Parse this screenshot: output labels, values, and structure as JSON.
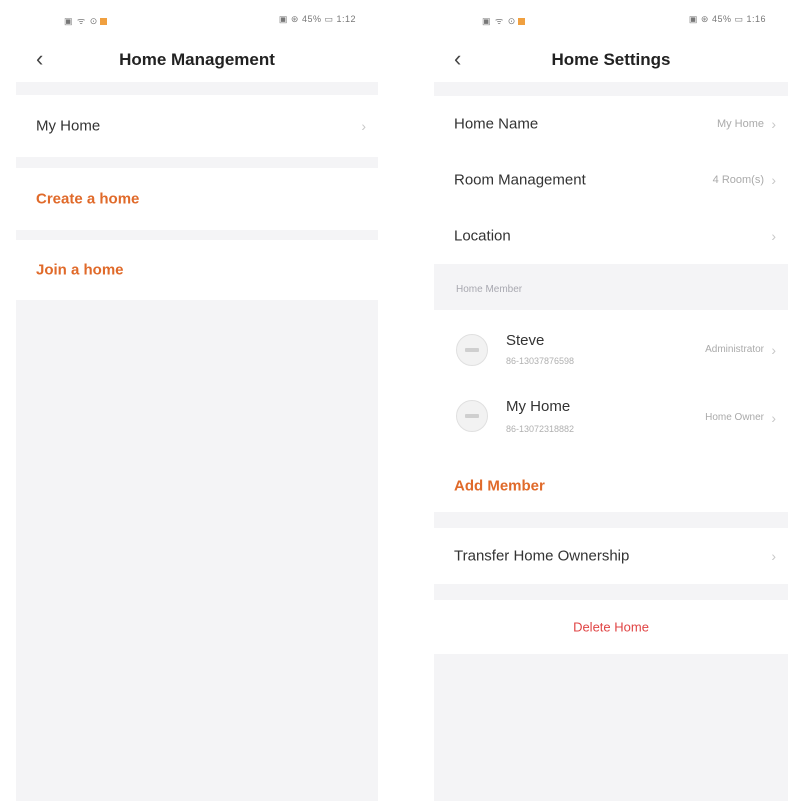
{
  "left": {
    "status": {
      "left": "▣ ᯤ ⊙",
      "right": "▣ ⊛ 45% ▭ 1:12"
    },
    "nav": {
      "title": "Home Management"
    },
    "items": {
      "my_home": "My Home",
      "create": "Create a home",
      "join": "Join a home"
    }
  },
  "right": {
    "status": {
      "left": "▣ ᯤ ⊙",
      "right": "▣ ⊛ 45% ▭ 1:16"
    },
    "nav": {
      "title": "Home Settings"
    },
    "settings": {
      "home_name": {
        "label": "Home Name",
        "value": "My Home"
      },
      "room_mgmt": {
        "label": "Room Management",
        "value": "4 Room(s)"
      },
      "location": {
        "label": "Location"
      }
    },
    "section_header": "Home Member",
    "members": [
      {
        "name": "Steve",
        "id": "86-13037876598",
        "role": "Administrator"
      },
      {
        "name": "My Home",
        "id": "86-13072318882",
        "role": "Home Owner"
      }
    ],
    "add_member": "Add Member",
    "transfer": "Transfer Home Ownership",
    "delete": "Delete Home"
  },
  "colors": {
    "accent": "#e06a2a",
    "danger": "#e04545",
    "background": "#f4f4f6"
  },
  "icons": {
    "back": "chevron-left-icon",
    "row_arrow": "chevron-right-icon",
    "avatar": "avatar-icon"
  }
}
